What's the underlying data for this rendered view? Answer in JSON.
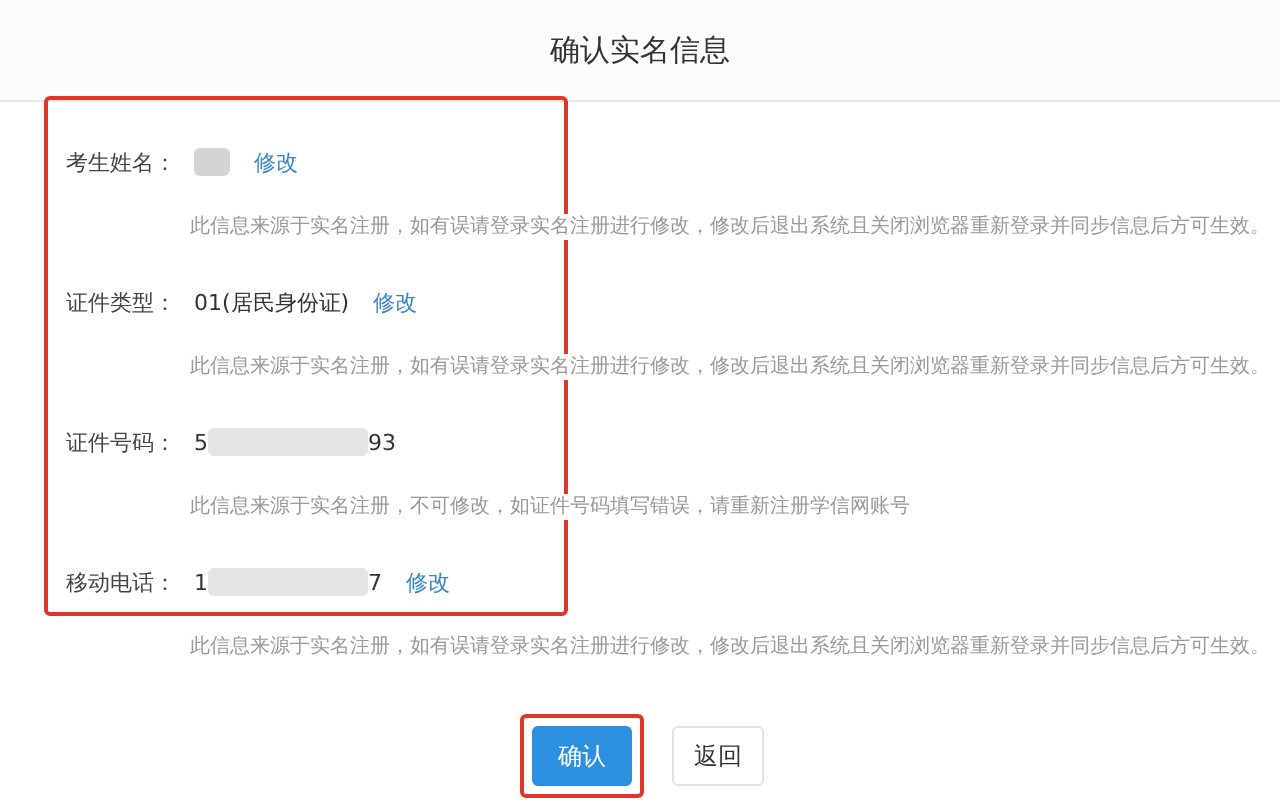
{
  "dialog": {
    "title": "确认实名信息"
  },
  "form": {
    "highlighted": true,
    "fields": [
      {
        "label": "考生姓名：",
        "value": [
          {
            "kind": "redacted"
          }
        ],
        "edit_link": "修改",
        "note": "此信息来源于实名注册，如有误请登录实名注册进行修改，修改后退出系统且关闭浏览器重新登录并同步信息后方可生效。"
      },
      {
        "label": "证件类型：",
        "value": [
          {
            "kind": "text",
            "text": "01(居民身份证)"
          }
        ],
        "edit_link": "修改",
        "note": "此信息来源于实名注册，如有误请登录实名注册进行修改，修改后退出系统且关闭浏览器重新登录并同步信息后方可生效。"
      },
      {
        "label": "证件号码：",
        "value": [
          {
            "kind": "text",
            "text": "5"
          },
          {
            "kind": "redacted_long"
          },
          {
            "kind": "text",
            "text": "93"
          }
        ],
        "note": "此信息来源于实名注册，不可修改，如证件号码填写错误，请重新注册学信网账号"
      },
      {
        "label": "移动电话：",
        "value": [
          {
            "kind": "text",
            "text": "1"
          },
          {
            "kind": "redacted_long"
          },
          {
            "kind": "text",
            "text": "7"
          }
        ],
        "edit_link": "修改",
        "note": "此信息来源于实名注册，如有误请登录实名注册进行修改，修改后退出系统且关闭浏览器重新登录并同步信息后方可生效。"
      }
    ]
  },
  "buttons": [
    {
      "label": "确认",
      "kind": "primary",
      "highlighted": true
    },
    {
      "label": "返回",
      "kind": "default",
      "highlighted": false
    }
  ]
}
